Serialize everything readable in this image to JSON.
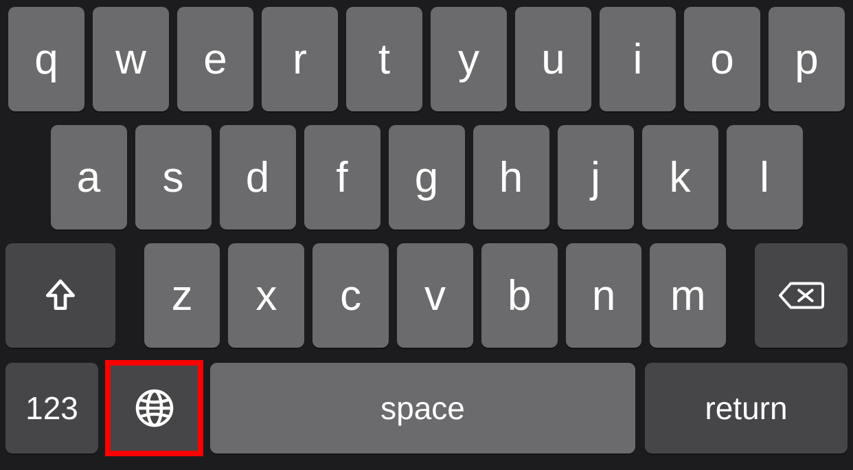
{
  "rows": {
    "r1": [
      "q",
      "w",
      "e",
      "r",
      "t",
      "y",
      "u",
      "i",
      "o",
      "p"
    ],
    "r2": [
      "a",
      "s",
      "d",
      "f",
      "g",
      "h",
      "j",
      "k",
      "l"
    ],
    "r3": [
      "z",
      "x",
      "c",
      "v",
      "b",
      "n",
      "m"
    ]
  },
  "bottom": {
    "numbers_label": "123",
    "space_label": "space",
    "return_label": "return"
  },
  "icons": {
    "shift": "shift-icon",
    "backspace": "backspace-icon",
    "globe": "globe-icon"
  },
  "highlight": {
    "target": "globe-key"
  },
  "colors": {
    "background": "#1c1c1e",
    "key_light": "#6b6b6d",
    "key_dark": "#464648",
    "text": "#ffffff",
    "highlight": "#ff0000"
  }
}
